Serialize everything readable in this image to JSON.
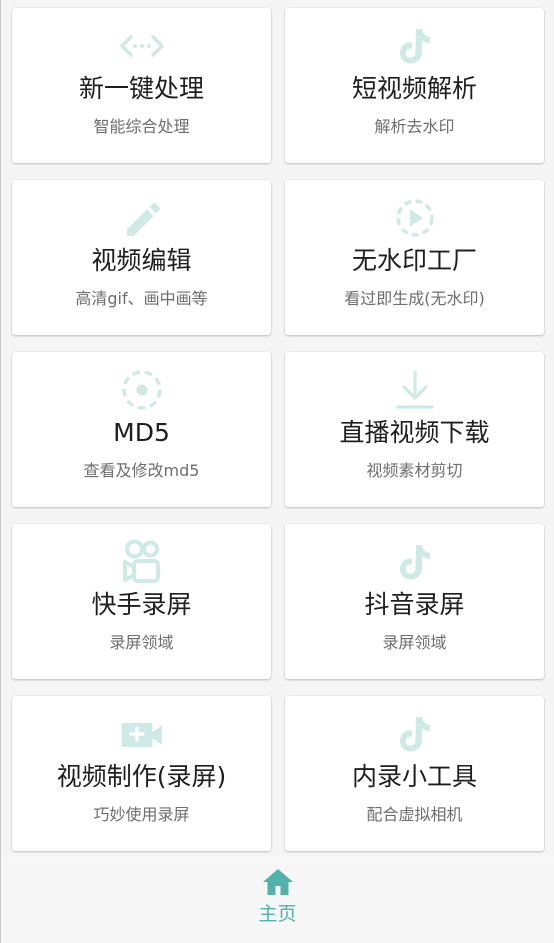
{
  "theme": {
    "icon_color": "#cdeae6",
    "accent": "#4fb3ab"
  },
  "cards": [
    {
      "icon": "code-icon",
      "title": "新一键处理",
      "subtitle": "智能综合处理"
    },
    {
      "icon": "tiktok-icon",
      "title": "短视频解析",
      "subtitle": "解析去水印"
    },
    {
      "icon": "pencil-icon",
      "title": "视频编辑",
      "subtitle": "高清gif、画中画等"
    },
    {
      "icon": "play-circle-icon",
      "title": "无水印工厂",
      "subtitle": "看过即生成(无水印)"
    },
    {
      "icon": "target-icon",
      "title": "MD5",
      "subtitle": "查看及修改md5"
    },
    {
      "icon": "download-icon",
      "title": "直播视频下载",
      "subtitle": "视频素材剪切"
    },
    {
      "icon": "kuaishou-icon",
      "title": "快手录屏",
      "subtitle": "录屏领域"
    },
    {
      "icon": "tiktok-icon",
      "title": "抖音录屏",
      "subtitle": "录屏领域"
    },
    {
      "icon": "video-add-icon",
      "title": "视频制作(录屏)",
      "subtitle": "巧妙使用录屏"
    },
    {
      "icon": "tiktok-icon",
      "title": "内录小工具",
      "subtitle": "配合虚拟相机"
    }
  ],
  "nav": {
    "home_label": "主页"
  }
}
